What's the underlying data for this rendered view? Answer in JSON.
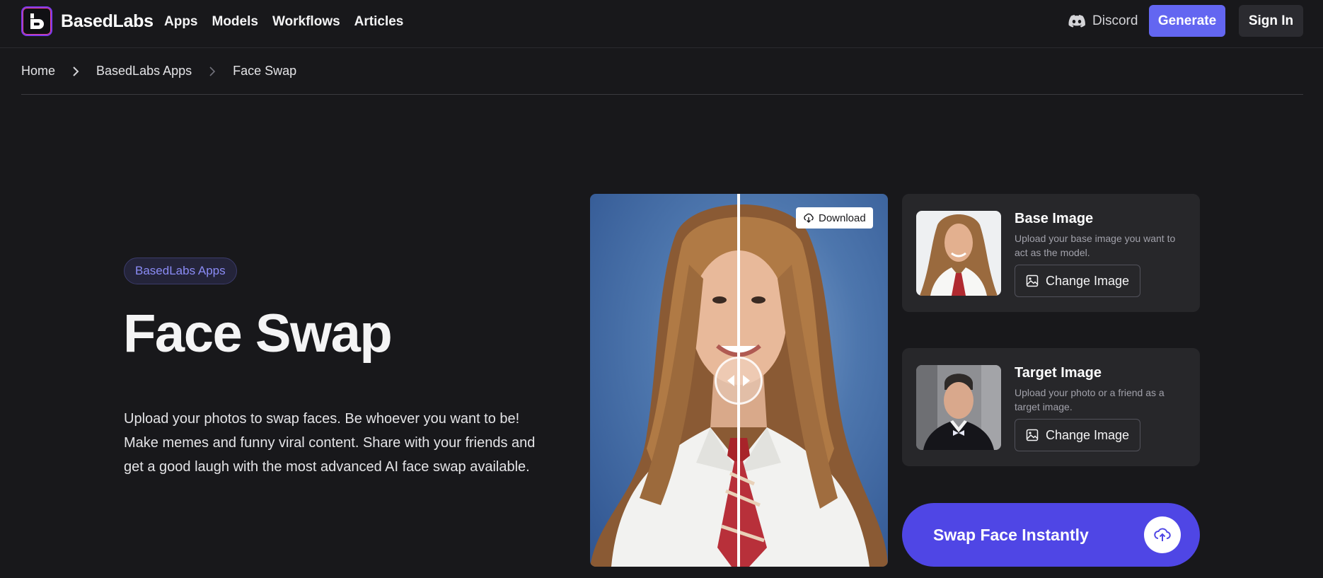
{
  "brand": {
    "name": "BasedLabs",
    "logo_icon": "basedlabs-logo-icon"
  },
  "nav": {
    "links": [
      "Apps",
      "Models",
      "Workflows",
      "Articles"
    ],
    "discord_label": "Discord",
    "generate_label": "Generate",
    "signin_label": "Sign In"
  },
  "breadcrumb": {
    "items": [
      "Home",
      "BasedLabs Apps"
    ],
    "current": "Face Swap"
  },
  "hero": {
    "pill": "BasedLabs Apps",
    "title": "Face Swap",
    "description": "Upload your photos to swap faces. Be whoever you want to be! Make memes and funny viral content. Share with your friends and get a good laugh with the most advanced AI face swap available."
  },
  "compare": {
    "download_label": "Download"
  },
  "base_card": {
    "title": "Base Image",
    "description": "Upload your base image you want to act as the model.",
    "button": "Change Image"
  },
  "target_card": {
    "title": "Target Image",
    "description": "Upload your photo or a friend as a target image.",
    "button": "Change Image"
  },
  "swap": {
    "label": "Swap Face Instantly"
  },
  "colors": {
    "background": "#18181b",
    "accent": "#6366f1",
    "swap_button": "#4f46e5",
    "card": "#27272a",
    "pill_text": "#8b8cf6"
  }
}
